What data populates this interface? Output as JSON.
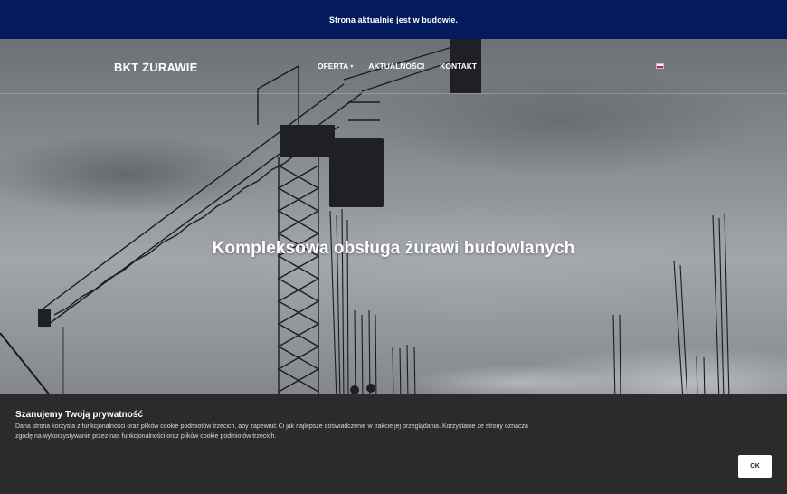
{
  "notice_bar": {
    "text": "Strona aktualnie jest w budowie."
  },
  "header": {
    "logo": "BKT ŻURAWIE",
    "nav": [
      {
        "label": "OFERTA",
        "has_dropdown": true
      },
      {
        "label": "AKTUALNOŚCI",
        "has_dropdown": false
      },
      {
        "label": "KONTAKT",
        "has_dropdown": false
      }
    ],
    "language_icon": "flag-pl-icon"
  },
  "hero": {
    "headline": "Kompleksowa obsługa żurawi budowlanych"
  },
  "cookie_banner": {
    "title": "Szanujemy Twoją prywatność",
    "text": "Dana strona korzysta z funkcjonalności oraz plików cookie podmiotów trzecich, aby zapewnić Ci jak najlepsze doświadczenie w trakcie jej przeglądania. Korzystanie ze strony oznacza zgodę na wykorzystywanie przez nas funkcjonalności oraz plików cookie podmiotów trzecich.",
    "ok_label": "OK"
  },
  "colors": {
    "notice_bar": "#041a5e",
    "cookie_bg": "#2b2b2b"
  }
}
